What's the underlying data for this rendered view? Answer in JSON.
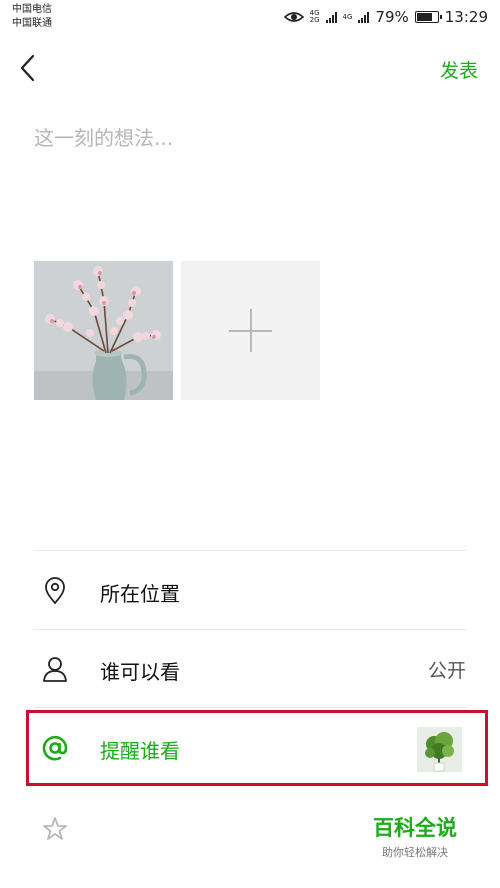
{
  "status_bar": {
    "carrier_1": "中国电信",
    "carrier_2": "中国联通",
    "net_1_top": "4G",
    "net_1_bottom": "2G",
    "net_2": "4G",
    "battery_percent": "79%",
    "battery_level": 0.79,
    "time": "13:29"
  },
  "nav": {
    "back_icon": "chevron-left-icon",
    "publish_label": "发表"
  },
  "composer": {
    "placeholder": "这一刻的想法..."
  },
  "images": {
    "photo_icon": "cherry-blossom-vase-photo",
    "add_icon": "plus-icon"
  },
  "options": [
    {
      "icon": "location-pin-icon",
      "label": "所在位置",
      "value": ""
    },
    {
      "icon": "person-icon",
      "label": "谁可以看",
      "value": "公开"
    },
    {
      "icon": "at-sign-icon",
      "label": "提醒谁看",
      "value": ""
    },
    {
      "icon": "star-icon",
      "label": "",
      "value": ""
    }
  ],
  "watermark": {
    "title": "百科全说",
    "subtitle": "助你轻松解决"
  },
  "colors": {
    "accent_green": "#1aad19",
    "highlight_red": "#c8102e",
    "placeholder_gray": "#b6b6b6"
  }
}
